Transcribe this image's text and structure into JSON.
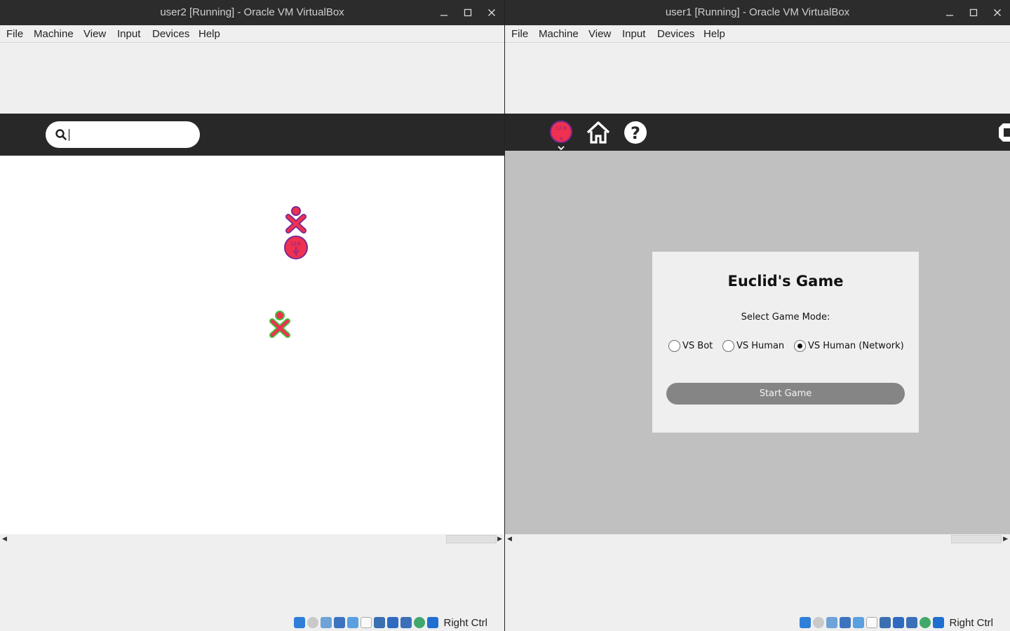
{
  "left_window": {
    "title": "user2 [Running] - Oracle VM VirtualBox",
    "menu": [
      "File",
      "Machine",
      "View",
      "Input",
      "Devices",
      "Help"
    ],
    "search": {
      "placeholder": ""
    },
    "host_key": "Right Ctrl"
  },
  "right_window": {
    "title": "user1 [Running] - Oracle VM VirtualBox",
    "menu": [
      "File",
      "Machine",
      "View",
      "Input",
      "Devices",
      "Help"
    ],
    "toolbar": {
      "icons": [
        "activity-icon",
        "home-icon",
        "help-icon",
        "stop-icon"
      ]
    },
    "game": {
      "title": "Euclid's Game",
      "mode_label": "Select Game Mode:",
      "modes": [
        {
          "label": "VS Bot",
          "selected": false
        },
        {
          "label": "VS Human",
          "selected": false
        },
        {
          "label": "VS Human (Network)",
          "selected": true
        }
      ],
      "start_label": "Start Game"
    },
    "host_key": "Right Ctrl"
  },
  "colors": {
    "titlebar": "#2c2c2c",
    "sugar_toolbar": "#282828",
    "game_background": "#c0c0c0",
    "xo_red": "#f03050",
    "xo_purple": "#7a2a90",
    "xo_green": "#3dc43d"
  }
}
